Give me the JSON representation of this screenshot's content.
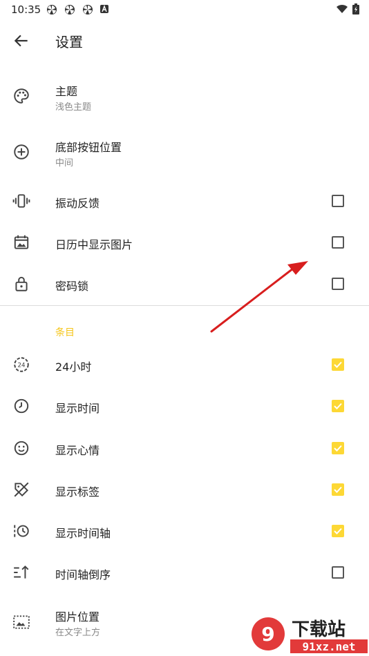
{
  "status": {
    "time": "10:35",
    "notification_icons": [
      "pinwheel-icon",
      "pinwheel-icon",
      "pinwheel-icon",
      "a-box-icon"
    ],
    "right_icons": [
      "wifi-icon",
      "battery-charging-icon"
    ]
  },
  "appbar": {
    "title": "设置"
  },
  "settings": [
    {
      "label": "主题",
      "sub": "浅色主题",
      "icon": "palette-icon"
    },
    {
      "label": "底部按钮位置",
      "sub": "中间",
      "icon": "add-circle-icon"
    },
    {
      "label": "振动反馈",
      "icon": "vibration-icon",
      "checked": false
    },
    {
      "label": "日历中显示图片",
      "icon": "calendar-image-icon",
      "checked": false
    },
    {
      "label": "密码锁",
      "icon": "lock-icon",
      "checked": false
    }
  ],
  "section": {
    "title": "条目"
  },
  "entries": [
    {
      "label": "24小时",
      "icon": "clock-24-icon",
      "checked": true
    },
    {
      "label": "显示时间",
      "icon": "clock-icon",
      "checked": true
    },
    {
      "label": "显示心情",
      "icon": "smiley-icon",
      "checked": true
    },
    {
      "label": "显示标签",
      "icon": "tag-off-icon",
      "checked": true
    },
    {
      "label": "显示时间轴",
      "icon": "timeline-icon",
      "checked": true
    },
    {
      "label": "时间轴倒序",
      "icon": "sort-ascending-icon",
      "checked": false
    },
    {
      "label": "图片位置",
      "sub": "在文字上方",
      "icon": "image-position-icon"
    }
  ],
  "colors": {
    "accent": "#fdd835",
    "section": "#f5c518",
    "annotation_arrow": "#d81e1e"
  },
  "watermark": {
    "brand": "下载站",
    "domain": "91xz.net"
  }
}
